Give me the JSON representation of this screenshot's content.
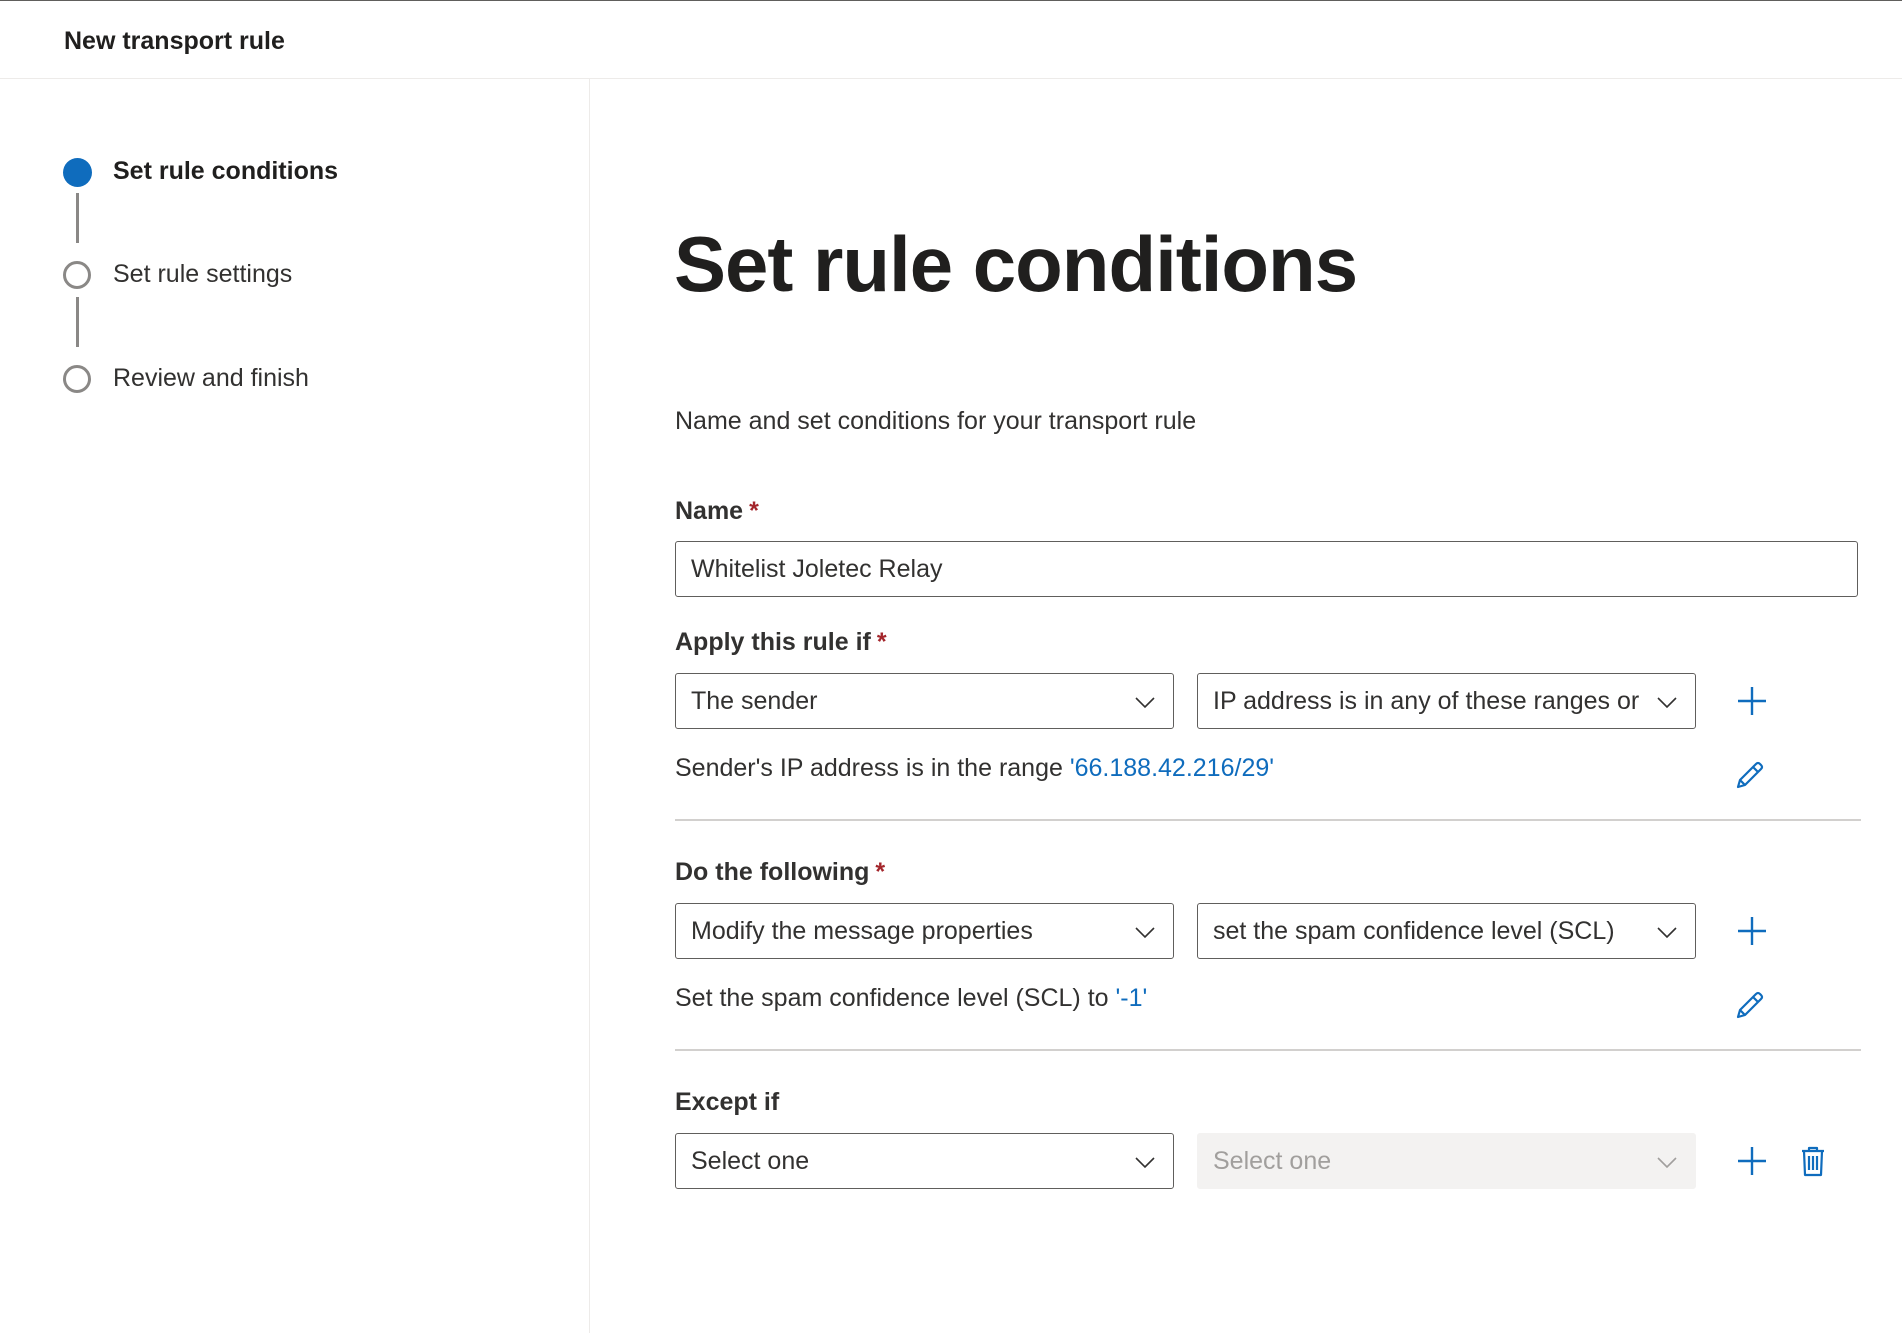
{
  "header": {
    "title": "New transport rule"
  },
  "steps": [
    {
      "label": "Set rule conditions",
      "state": "active"
    },
    {
      "label": "Set rule settings",
      "state": "upcoming"
    },
    {
      "label": "Review and finish",
      "state": "upcoming"
    }
  ],
  "main": {
    "title": "Set rule conditions",
    "description": "Name and set conditions for your transport rule",
    "name_field": {
      "label": "Name",
      "required_mark": "*",
      "value": "Whitelist Joletec Relay"
    },
    "apply_if": {
      "label": "Apply this rule if",
      "required_mark": "*",
      "condition_value": "The sender",
      "predicate_value": "IP address is in any of these ranges or ...",
      "summary_text": "Sender's IP address is in the range",
      "summary_link": "'66.188.42.216/29'"
    },
    "do_following": {
      "label": "Do the following",
      "required_mark": "*",
      "action_value": "Modify the message properties",
      "property_value": "set the spam confidence level (SCL)",
      "summary_text": "Set the spam confidence level (SCL) to",
      "summary_link": "'-1'"
    },
    "except_if": {
      "label": "Except if",
      "condition_value": "Select one",
      "predicate_value": "Select one"
    }
  },
  "icons": {
    "add": "add-icon",
    "edit": "pencil-icon",
    "delete": "trash-icon",
    "dropdown": "chevron-down-icon"
  },
  "colors": {
    "accent": "#0f6cbd",
    "required": "#a4262c",
    "border": "#605e5c",
    "disabled_bg": "#f3f2f1"
  }
}
